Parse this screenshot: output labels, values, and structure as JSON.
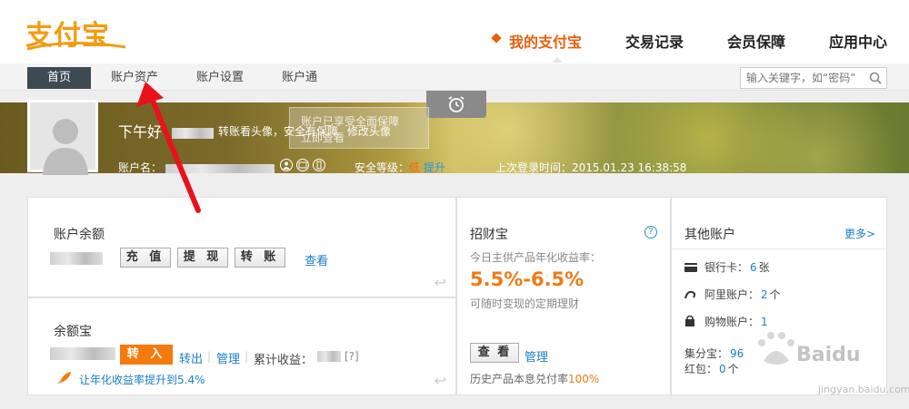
{
  "logo": {
    "text": "支付宝"
  },
  "main_nav": [
    {
      "label": "我的支付宝",
      "active": true
    },
    {
      "label": "交易记录"
    },
    {
      "label": "会员保障"
    },
    {
      "label": "应用中心"
    }
  ],
  "sub_nav": [
    {
      "label": "首页",
      "active": true
    },
    {
      "label": "账户资产"
    },
    {
      "label": "账户设置"
    },
    {
      "label": "账户通"
    }
  ],
  "search": {
    "placeholder": "输入关键字，如“密码”"
  },
  "banner": {
    "greeting": "下午好",
    "avatar_tip": "转账看头像，安全有保障",
    "change_avatar": "修改头像",
    "overlay_tip": "账户已享受全面保障",
    "overlay_tip2": "立即查看",
    "account_label": "账户名：",
    "security_label": "安全等级：",
    "security_level": "低",
    "security_upgrade": "提升",
    "last_login_label": "上次登录时间：",
    "last_login": "2015.01.23 16:38:58"
  },
  "balance": {
    "title": "账户余额",
    "buttons": [
      "充 值",
      "提 现",
      "转 账"
    ],
    "view": "查看"
  },
  "yeb": {
    "title": "余额宝",
    "transfer_in": "转 入",
    "transfer_out": "转出",
    "manage": "管理",
    "income_label": "累计收益：",
    "help": "[?]",
    "promo": "让年化收益率提升到5.4%"
  },
  "zcb": {
    "title": "招财宝",
    "subtitle": "今日主供产品年化收益率：",
    "rate": "5.5%-6.5%",
    "desc": "可随时变现的定期理财",
    "view": "查 看",
    "manage": "管理",
    "history": "历史产品本息兑付率",
    "history_rate": "100%"
  },
  "other": {
    "title": "其他账户",
    "more": "更多>",
    "bank_label": "银行卡：",
    "bank_count": "6",
    "bank_unit": "张",
    "ali_label": "阿里账户：",
    "ali_count": "2",
    "ali_unit": "个",
    "shop_label": "购物账户：",
    "shop_count": "1",
    "jifen_label": "集分宝：",
    "jifen_count": "96",
    "hongbao_label": "红包：",
    "hongbao_count": "0",
    "hongbao_unit": "个"
  },
  "watermark": {
    "text": "Baidu经验",
    "url_text": "jingyan.baidu.com"
  },
  "colors": {
    "accent": "#e8600b",
    "link": "#1a7fc6",
    "orange_button": "#f57a0d",
    "subnav_active": "#3c4a52"
  }
}
